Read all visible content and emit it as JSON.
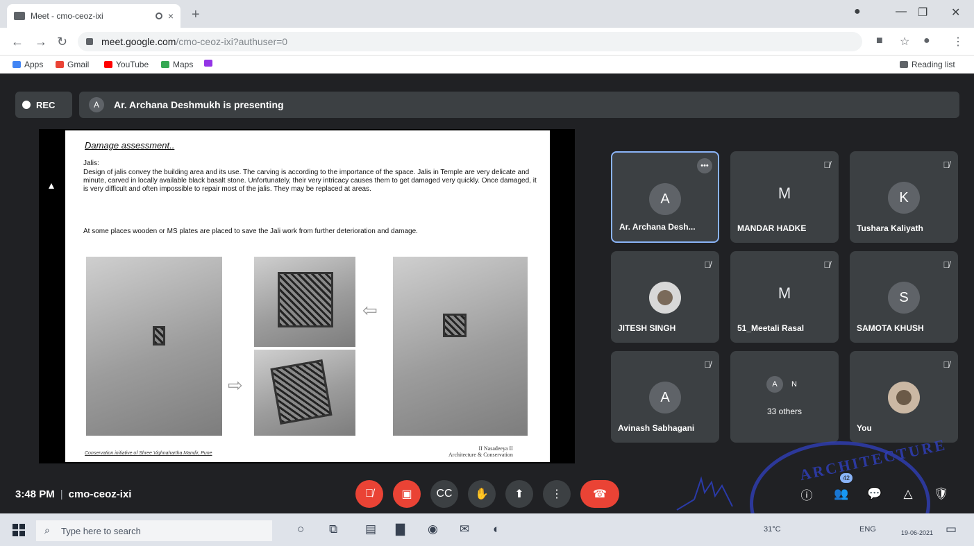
{
  "browser": {
    "tab_title": "Meet - cmo-ceoz-ixi",
    "tab_close": "×",
    "new_tab": "+",
    "url_host": "meet.google.com",
    "url_path": "/cmo-ceoz-ixi?authuser=0",
    "window_controls": [
      "—",
      "❐",
      "✕"
    ],
    "bookmarks": [
      {
        "label": "Apps",
        "icon": "apps-grid-icon",
        "color": "#4285f4"
      },
      {
        "label": "Gmail",
        "icon": "gmail-icon",
        "color": "#ea4335"
      },
      {
        "label": "YouTube",
        "icon": "youtube-icon",
        "color": "#ff0000"
      },
      {
        "label": "Maps",
        "icon": "maps-icon",
        "color": "#34a853"
      },
      {
        "label": "",
        "icon": "bookmark-icon",
        "color": "#9334e6"
      }
    ],
    "reading_list": "Reading list"
  },
  "meet": {
    "rec_label": "REC",
    "presenter_initial": "A",
    "presenting_text": "Ar. Archana Deshmukh is presenting",
    "time": "3:48 PM",
    "meeting_code": "cmo-ceoz-ixi",
    "people_count": "42"
  },
  "slide": {
    "title": "Damage assessment..",
    "subtitle": "Jalis:",
    "paragraph": "Design of jalis convey the building area and its use. The carving is according to the importance of the space. Jalis in Temple are very delicate and minute, carved in locally available black basalt stone. Unfortunately, their very intricacy causes them to get damaged very quickly. Once damaged, it is very difficult and often impossible to repair most of the jalis. They may be replaced at areas.",
    "note": "At some places wooden or MS plates are placed to save the Jali work from further deterioration and damage.",
    "footer_left": "Conservation initiative of Shree Vighnahartha Mandir, Pune",
    "footer_right_1": "II Nasadeeya II",
    "footer_right_2": "Architecture & Conservation"
  },
  "participants": [
    {
      "name": "Ar. Archana Desh...",
      "initial": "A",
      "avatar_color": "#5f6368",
      "muted": false,
      "active": true
    },
    {
      "name": "MANDAR HADKE",
      "initial": "M",
      "avatar_color": "none",
      "muted": true
    },
    {
      "name": "Tushara Kaliyath",
      "initial": "K",
      "avatar_color": "#5f6368",
      "muted": true
    },
    {
      "name": "JITESH SINGH",
      "initial": "",
      "avatar_color": "#d8d8d8",
      "muted": true
    },
    {
      "name": "51_Meetali Rasal",
      "initial": "M",
      "avatar_color": "none",
      "muted": true
    },
    {
      "name": "SAMOTA KHUSH",
      "initial": "S",
      "avatar_color": "#5f6368",
      "muted": true
    },
    {
      "name": "Avinash Sabhagani",
      "initial": "A",
      "avatar_color": "#5f6368",
      "muted": true
    },
    {
      "name": "",
      "initial": "",
      "avatar_color": "none",
      "muted": false
    },
    {
      "name": "You",
      "initial": "",
      "avatar_color": "#cbb8a4",
      "muted": true
    }
  ],
  "others_tile": {
    "initials": [
      "A",
      "N"
    ],
    "label": "33 others"
  },
  "controls": {
    "mic": "mic-off-icon",
    "camera": "camera-off-icon",
    "captions": "captions-icon",
    "hand": "raise-hand-icon",
    "present": "present-icon",
    "more": "more-options-icon",
    "hangup": "hang-up-icon"
  },
  "stamp_text": "ARCHITECTURE",
  "taskbar": {
    "search_placeholder": "Type here to search",
    "weather": "31°C",
    "lang": "ENG",
    "date": "19-06-2021"
  }
}
